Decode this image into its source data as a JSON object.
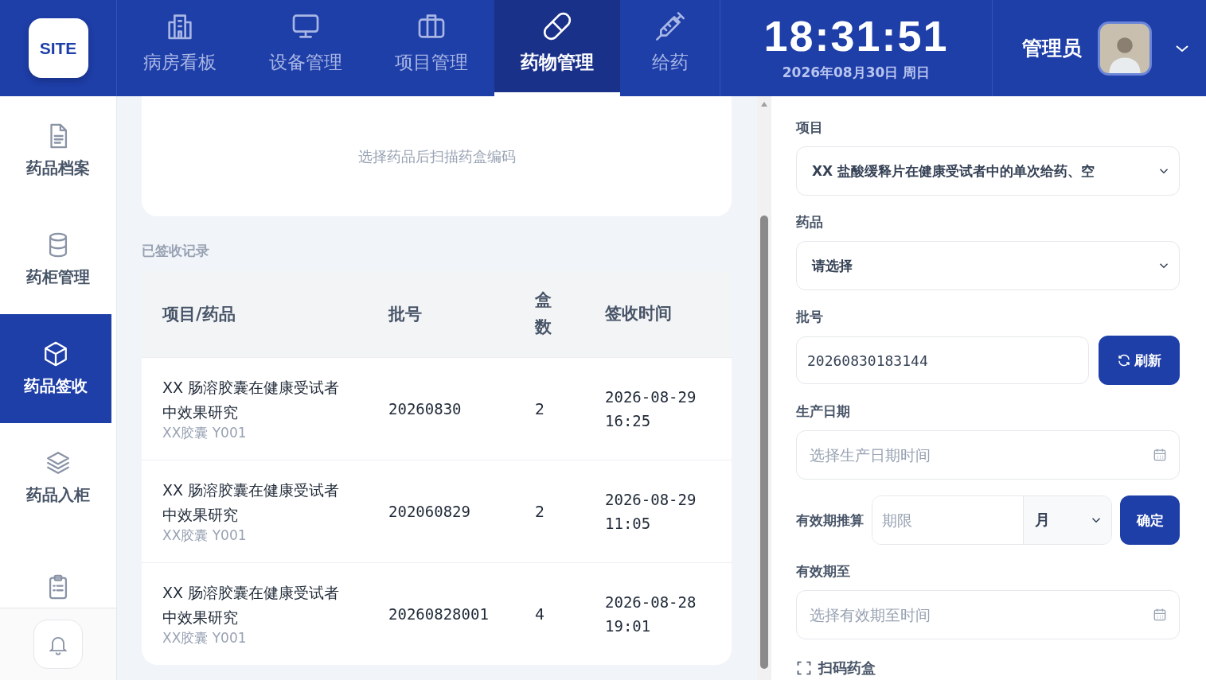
{
  "header": {
    "logo": "SITE",
    "nav_tabs": [
      {
        "label": "病房看板",
        "selected": false
      },
      {
        "label": "设备管理",
        "selected": false
      },
      {
        "label": "项目管理",
        "selected": false
      },
      {
        "label": "药物管理",
        "selected": true
      },
      {
        "label": "给药",
        "selected": false
      }
    ],
    "clock": {
      "time": "18:31:51",
      "date": "2026年08月30日 周日"
    },
    "user": {
      "name": "管理员"
    }
  },
  "sidebar": {
    "items": [
      {
        "label": "药品档案",
        "selected": false
      },
      {
        "label": "药柜管理",
        "selected": false
      },
      {
        "label": "药品签收",
        "selected": true
      },
      {
        "label": "药品入柜",
        "selected": false
      },
      {
        "selected": false
      }
    ]
  },
  "scan_card": {
    "hint": "选择药品后扫描药盒编码"
  },
  "records": {
    "title": "已签收记录",
    "columns": [
      "项目/药品",
      "批号",
      "盒数",
      "签收时间"
    ],
    "rows": [
      {
        "project": "XX 肠溶胶囊在健康受试者中效果研究",
        "drug": "XX胶囊 Y001",
        "batch": "20260830",
        "boxes": "2",
        "time": "2026-08-29 16:25"
      },
      {
        "project": "XX 肠溶胶囊在健康受试者中效果研究",
        "drug": "XX胶囊 Y001",
        "batch": "202060829",
        "boxes": "2",
        "time": "2026-08-29 11:05"
      },
      {
        "project": "XX 肠溶胶囊在健康受试者中效果研究",
        "drug": "XX胶囊 Y001",
        "batch": "20260828001",
        "boxes": "4",
        "time": "2026-08-28 19:01"
      }
    ]
  },
  "form": {
    "project": {
      "label": "项目",
      "value": "XX 盐酸缓释片在健康受试者中的单次给药、空"
    },
    "drug": {
      "label": "药品",
      "value": "请选择"
    },
    "batch": {
      "label": "批号",
      "value": "20260830183144",
      "button": "刷新"
    },
    "production_date": {
      "label": "生产日期",
      "placeholder": "选择生产日期时间"
    },
    "expiry_calc": {
      "label": "有效期推算",
      "placeholder": "期限",
      "unit": "月",
      "button": "确定"
    },
    "expiry_date": {
      "label": "有效期至",
      "placeholder": "选择有效期至时间"
    },
    "scan_link": "扫码药盒"
  }
}
